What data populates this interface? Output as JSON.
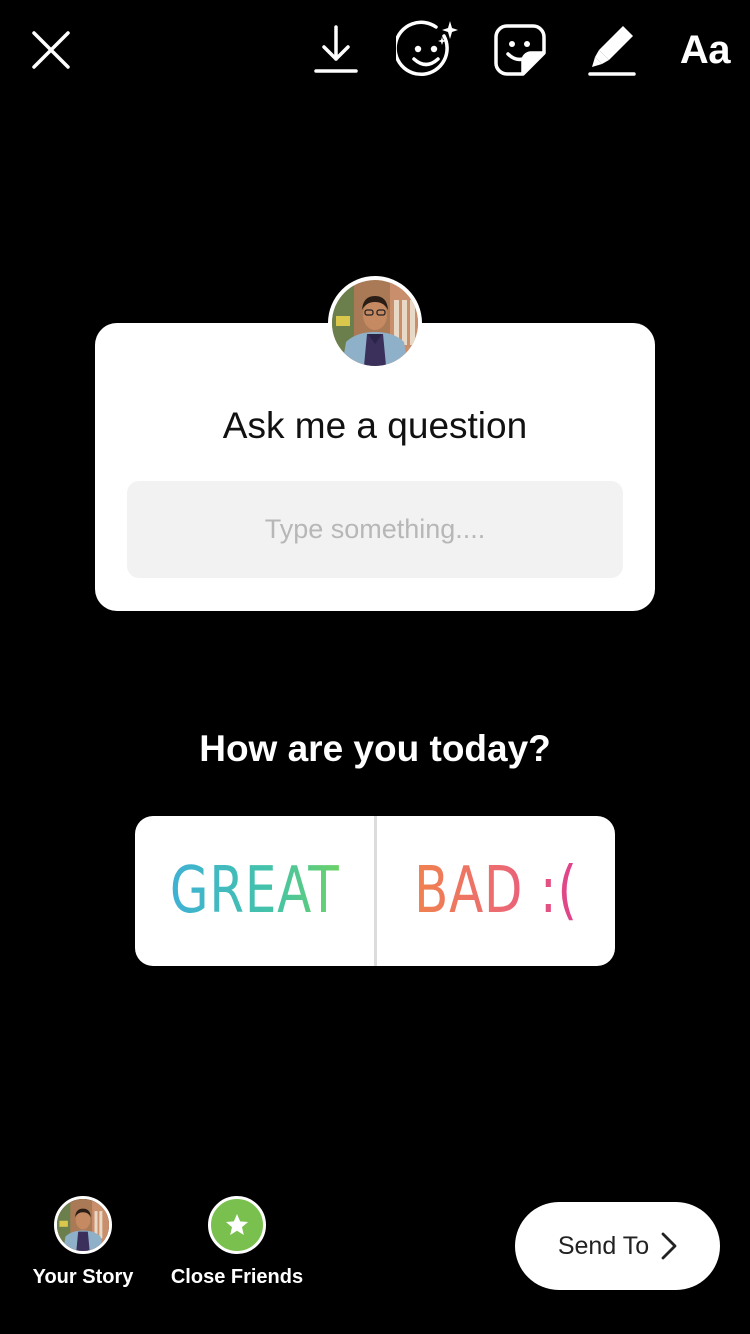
{
  "toolbar": {
    "close_icon": "close-icon",
    "download_icon": "download-icon",
    "effects_icon": "face-effects-icon",
    "sticker_icon": "sticker-icon",
    "draw_icon": "draw-marker-icon",
    "text_label": "Aa"
  },
  "question_sticker": {
    "title": "Ask me a question",
    "placeholder": "Type something...."
  },
  "poll_sticker": {
    "question": "How are you today?",
    "options": [
      "GREAT",
      "BAD :("
    ]
  },
  "bottom_bar": {
    "your_story_label": "Your Story",
    "close_friends_label": "Close Friends",
    "send_label": "Send To",
    "colors": {
      "close_friends_green": "#7ac04e"
    }
  }
}
